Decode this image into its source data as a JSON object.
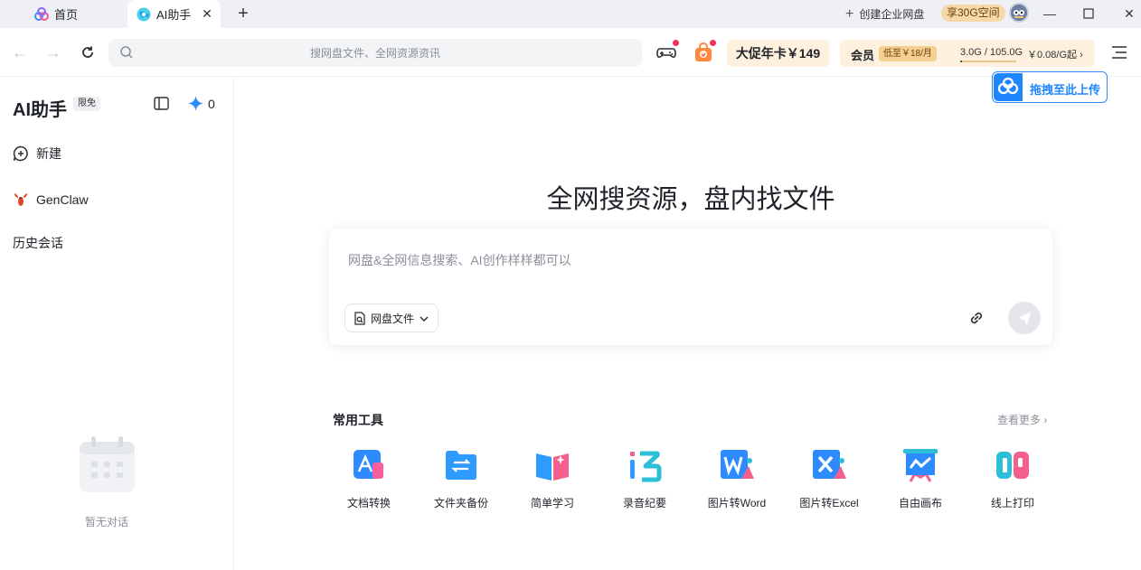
{
  "tabs": {
    "home": "首页",
    "ai": "AI助手",
    "close": "✕",
    "add": "+"
  },
  "titlebar": {
    "create_enterprise": "创建企业网盘",
    "storage_badge": "享30G空间"
  },
  "toolbar": {
    "search_placeholder": "搜网盘文件、全网资源资讯",
    "promo": "大促年卡￥149",
    "vip_label": "会员",
    "vip_price": "低至￥18/月",
    "storage_text": "3.0G / 105.0G",
    "storage_used_fraction": 0.029,
    "storage_price": "￥0.08/G起 ›"
  },
  "upload": {
    "label": "拖拽至此上传"
  },
  "sidebar": {
    "title": "AI助手",
    "tag": "限免",
    "credits": "0",
    "new_label": "新建",
    "genclaw_label": "GenClaw",
    "history_label": "历史会话",
    "empty_label": "暂无对话"
  },
  "main": {
    "hero": "全网搜资源，盘内找文件",
    "chat_placeholder": "网盘&全网信息搜索、AI创作样样都可以",
    "scope_label": "网盘文件",
    "tools_title": "常用工具",
    "tools_more": "查看更多 ›",
    "tools": [
      {
        "label": "文档转换",
        "icon": "doc-convert-icon"
      },
      {
        "label": "文件夹备份",
        "icon": "folder-backup-icon"
      },
      {
        "label": "简单学习",
        "icon": "book-icon"
      },
      {
        "label": "录音纪要",
        "icon": "recording-icon"
      },
      {
        "label": "图片转Word",
        "icon": "image-to-word-icon"
      },
      {
        "label": "图片转Excel",
        "icon": "image-to-excel-icon"
      },
      {
        "label": "自由画布",
        "icon": "canvas-icon"
      },
      {
        "label": "线上打印",
        "icon": "print-icon"
      }
    ]
  },
  "colors": {
    "accent_blue": "#1f86ff",
    "promo_bg": "#fdf0dd",
    "badge_gold": "#f7d9a8",
    "red_dot": "#f5325b"
  }
}
